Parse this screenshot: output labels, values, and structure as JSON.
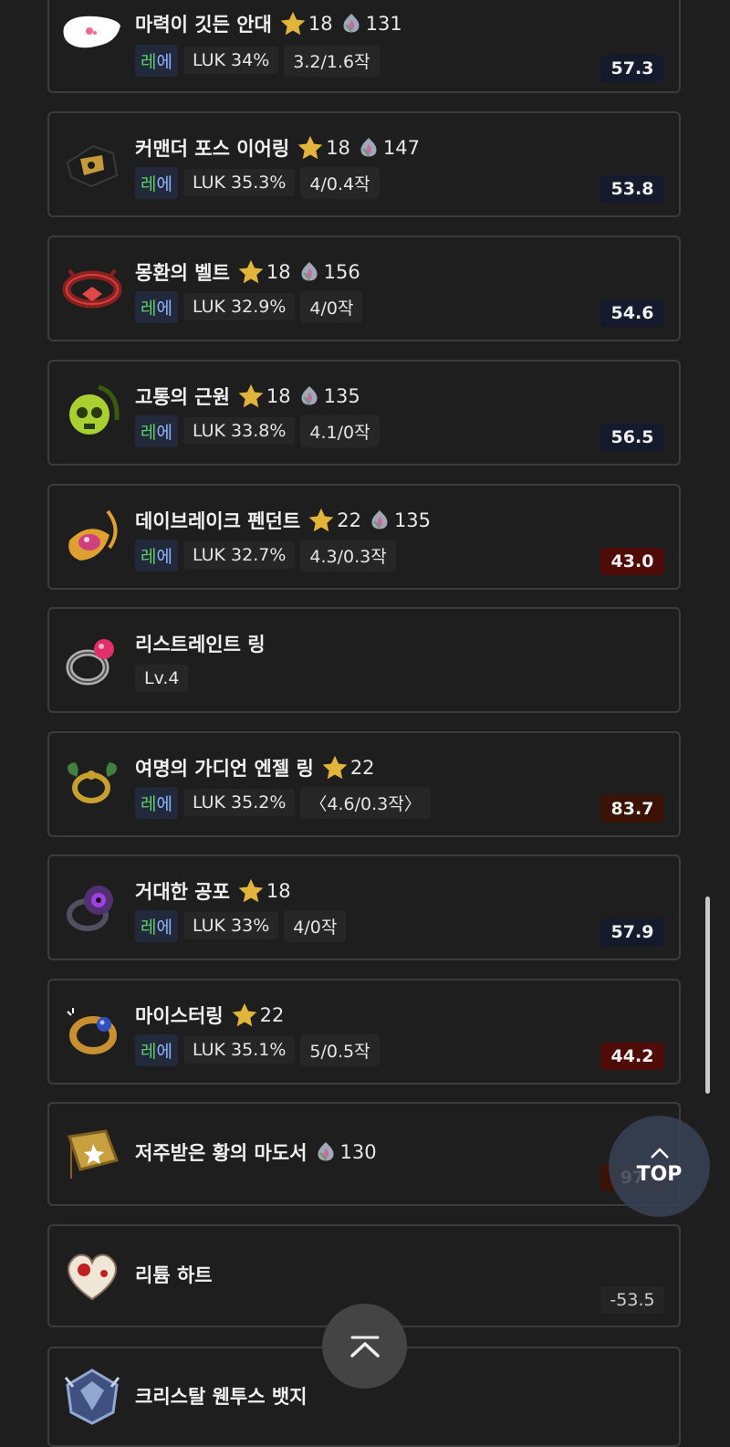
{
  "items": [
    {
      "name": "마력이 깃든 안대",
      "star": "18",
      "flame": "131",
      "grade_a": "레",
      "grade_b": "에",
      "stat": "LUK 34%",
      "scroll": "3.2/1.6작",
      "score": "57.3",
      "score_style": "dark",
      "icon": "eyepatch-icon",
      "colors": [
        "#ffffff",
        "#f06a8a"
      ]
    },
    {
      "name": "커맨더 포스 이어링",
      "star": "18",
      "flame": "147",
      "grade_a": "레",
      "grade_b": "에",
      "stat": "LUK 35.3%",
      "scroll": "4/0.4작",
      "score": "53.8",
      "score_style": "dark",
      "icon": "earring-icon",
      "colors": [
        "#1c1c1c",
        "#c49a3a"
      ]
    },
    {
      "name": "몽환의 벨트",
      "star": "18",
      "flame": "156",
      "grade_a": "레",
      "grade_b": "에",
      "stat": "LUK 32.9%",
      "scroll": "4/0작",
      "score": "54.6",
      "score_style": "dark",
      "icon": "belt-icon",
      "colors": [
        "#8a2020",
        "#d84040"
      ]
    },
    {
      "name": "고통의 근원",
      "star": "18",
      "flame": "135",
      "grade_a": "레",
      "grade_b": "에",
      "stat": "LUK 33.8%",
      "scroll": "4.1/0작",
      "score": "56.5",
      "score_style": "dark",
      "icon": "skull-pendant-icon",
      "colors": [
        "#a8d030",
        "#3a5a10"
      ]
    },
    {
      "name": "데이브레이크 펜던트",
      "star": "22",
      "flame": "135",
      "grade_a": "레",
      "grade_b": "에",
      "stat": "LUK 32.7%",
      "scroll": "4.3/0.3작",
      "score": "43.0",
      "score_style": "red",
      "icon": "pendant-icon",
      "colors": [
        "#e0a030",
        "#d04080"
      ]
    },
    {
      "name": "리스트레인트 링",
      "level": "Lv.4",
      "icon": "ring-icon",
      "colors": [
        "#b0b0b0",
        "#e0306a"
      ]
    },
    {
      "name": "여명의 가디언 엔젤 링",
      "star": "22",
      "grade_a": "레",
      "grade_b": "에",
      "stat": "LUK 35.2%",
      "scroll": "〈4.6/0.3작〉",
      "score": "83.7",
      "score_style": "red2",
      "icon": "angel-ring-icon",
      "colors": [
        "#c8a030",
        "#408040"
      ]
    },
    {
      "name": "거대한 공포",
      "star": "18",
      "grade_a": "레",
      "grade_b": "에",
      "stat": "LUK 33%",
      "scroll": "4/0작",
      "score": "57.9",
      "score_style": "dark",
      "icon": "eye-ring-icon",
      "colors": [
        "#503070",
        "#a040e0"
      ]
    },
    {
      "name": "마이스터링",
      "star": "22",
      "grade_a": "레",
      "grade_b": "에",
      "stat": "LUK 35.1%",
      "scroll": "5/0.5작",
      "score": "44.2",
      "score_style": "red",
      "icon": "meister-ring-icon",
      "colors": [
        "#c89030",
        "#3050c0"
      ]
    },
    {
      "name": "저주받은 황의 마도서",
      "flame": "130",
      "score": "97",
      "score_style": "red2",
      "icon": "spellbook-icon",
      "colors": [
        "#c8a040",
        "#806020"
      ]
    },
    {
      "name": "리튬 하트",
      "score": "-53.5",
      "score_style": "gray",
      "icon": "heart-icon",
      "colors": [
        "#f0e6d8",
        "#c02020"
      ]
    },
    {
      "name": "크리스탈 웬투스 뱃지",
      "icon": "badge-icon",
      "colors": [
        "#90a8d0",
        "#405080"
      ]
    }
  ],
  "top_button": {
    "label": "TOP"
  },
  "star_color": "#e2b43a",
  "accent_colors": {
    "rare_green": "#5fd06a",
    "rare_blue": "#8cb4ff"
  }
}
